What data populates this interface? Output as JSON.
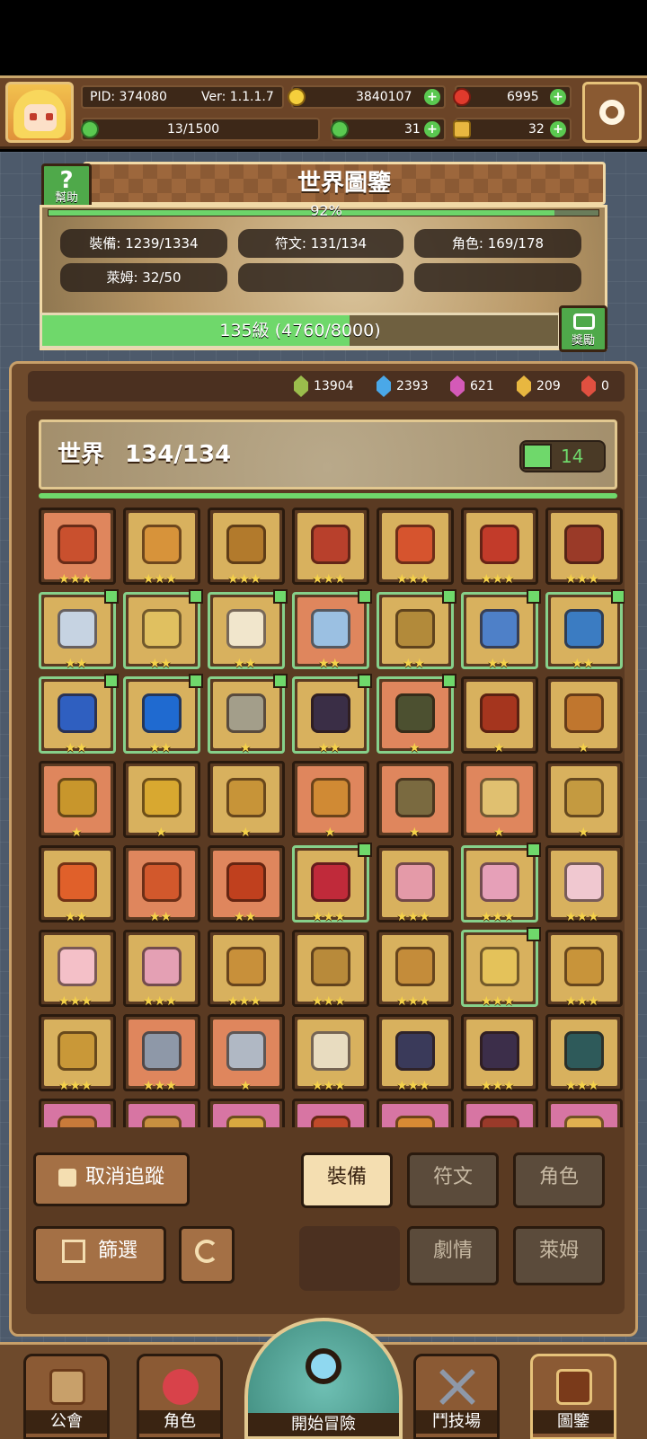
{
  "hud": {
    "pid": "PID: 374080",
    "ver": "Ver: 1.1.1.7",
    "gold": "3840107",
    "ruby": "6995",
    "stamina": "13/1500",
    "clover": "31",
    "key": "32"
  },
  "atlas": {
    "title": "世界圖鑒",
    "help": "幫助",
    "percent": "92%",
    "percent_value": 0.92,
    "stats": [
      "裝備: 1239/1334",
      "符文: 131/134",
      "角色: 169/178",
      "萊姆: 32/50"
    ],
    "level_text": "135級 (4760/8000)",
    "level_progress": 0.595,
    "reward": "獎勵"
  },
  "gems": [
    {
      "color": "#9bbd4c",
      "value": "13904"
    },
    {
      "color": "#4aa8e8",
      "value": "2393"
    },
    {
      "color": "#d45ab8",
      "value": "621"
    },
    {
      "color": "#e8b740",
      "value": "209"
    },
    {
      "color": "#e05040",
      "value": "0"
    }
  ],
  "world": {
    "title": "世界",
    "count": "134/134",
    "likes": "14"
  },
  "items": [
    {
      "bg": "orange",
      "stars": 3,
      "thumb": false,
      "color": "#c9502e"
    },
    {
      "bg": "gold",
      "stars": 3,
      "thumb": false,
      "color": "#d7933a"
    },
    {
      "bg": "gold",
      "stars": 3,
      "thumb": false,
      "color": "#b27a2c"
    },
    {
      "bg": "gold",
      "stars": 3,
      "thumb": false,
      "color": "#b8402c"
    },
    {
      "bg": "gold",
      "stars": 3,
      "thumb": false,
      "color": "#d6542e"
    },
    {
      "bg": "gold",
      "stars": 3,
      "thumb": false,
      "color": "#c23b2a"
    },
    {
      "bg": "gold",
      "stars": 3,
      "thumb": false,
      "color": "#9a3a28"
    },
    {
      "bg": "gold",
      "stars": 2,
      "thumb": true,
      "color": "#c6d3e2",
      "green": true
    },
    {
      "bg": "gold",
      "stars": 2,
      "thumb": true,
      "color": "#e0c060",
      "green": true
    },
    {
      "bg": "gold",
      "stars": 2,
      "thumb": true,
      "color": "#f1e6cc",
      "green": true
    },
    {
      "bg": "orange",
      "stars": 2,
      "thumb": true,
      "color": "#9bc0e2",
      "green": true
    },
    {
      "bg": "gold",
      "stars": 2,
      "thumb": true,
      "color": "#b28a3a",
      "green": true
    },
    {
      "bg": "gold",
      "stars": 2,
      "thumb": true,
      "color": "#4e80c8",
      "green": true
    },
    {
      "bg": "gold",
      "stars": 2,
      "thumb": true,
      "color": "#3b7cc2",
      "green": true
    },
    {
      "bg": "gold",
      "stars": 2,
      "thumb": true,
      "color": "#2f5fc0",
      "green": true
    },
    {
      "bg": "gold",
      "stars": 2,
      "thumb": true,
      "color": "#1f6ad0",
      "green": true
    },
    {
      "bg": "gold",
      "stars": 1,
      "thumb": true,
      "color": "#a39e8a",
      "green": true
    },
    {
      "bg": "gold",
      "stars": 2,
      "thumb": true,
      "color": "#3a2e46",
      "green": true
    },
    {
      "bg": "orange",
      "stars": 1,
      "thumb": true,
      "color": "#4c5030",
      "green": true
    },
    {
      "bg": "gold",
      "stars": 1,
      "thumb": false,
      "color": "#a5351e"
    },
    {
      "bg": "gold",
      "stars": 1,
      "thumb": false,
      "color": "#c0762e"
    },
    {
      "bg": "orange",
      "stars": 1,
      "thumb": false,
      "color": "#c8962c"
    },
    {
      "bg": "gold",
      "stars": 1,
      "thumb": false,
      "color": "#d8a830"
    },
    {
      "bg": "gold",
      "stars": 1,
      "thumb": false,
      "color": "#c79438"
    },
    {
      "bg": "orange",
      "stars": 1,
      "thumb": false,
      "color": "#d08a34"
    },
    {
      "bg": "orange",
      "stars": 1,
      "thumb": false,
      "color": "#7a6a40"
    },
    {
      "bg": "orange",
      "stars": 1,
      "thumb": false,
      "color": "#e0c070"
    },
    {
      "bg": "gold",
      "stars": 1,
      "thumb": false,
      "color": "#c49a40"
    },
    {
      "bg": "gold",
      "stars": 2,
      "thumb": false,
      "color": "#e0602a"
    },
    {
      "bg": "orange",
      "stars": 2,
      "thumb": false,
      "color": "#d2582c"
    },
    {
      "bg": "orange",
      "stars": 2,
      "thumb": false,
      "color": "#c0401e"
    },
    {
      "bg": "gold",
      "stars": 3,
      "thumb": true,
      "color": "#c02a3a",
      "green": true
    },
    {
      "bg": "gold",
      "stars": 3,
      "thumb": false,
      "color": "#e49aa8"
    },
    {
      "bg": "gold",
      "stars": 3,
      "thumb": true,
      "color": "#e6a0b8",
      "green": true
    },
    {
      "bg": "gold",
      "stars": 3,
      "thumb": false,
      "color": "#f0c8d0"
    },
    {
      "bg": "gold",
      "stars": 3,
      "thumb": false,
      "color": "#f4c0c8"
    },
    {
      "bg": "gold",
      "stars": 3,
      "thumb": false,
      "color": "#e4a0b4"
    },
    {
      "bg": "gold",
      "stars": 3,
      "thumb": false,
      "color": "#c8903a"
    },
    {
      "bg": "gold",
      "stars": 3,
      "thumb": false,
      "color": "#b88a3a"
    },
    {
      "bg": "gold",
      "stars": 3,
      "thumb": false,
      "color": "#c48c3a"
    },
    {
      "bg": "gold",
      "stars": 3,
      "thumb": true,
      "color": "#e4c25a",
      "green": true
    },
    {
      "bg": "gold",
      "stars": 3,
      "thumb": false,
      "color": "#c8943a"
    },
    {
      "bg": "gold",
      "stars": 3,
      "thumb": false,
      "color": "#c99838"
    },
    {
      "bg": "orange",
      "stars": 3,
      "thumb": false,
      "color": "#8e98a8"
    },
    {
      "bg": "orange",
      "stars": 1,
      "thumb": false,
      "color": "#b0b8c4"
    },
    {
      "bg": "gold",
      "stars": 3,
      "thumb": false,
      "color": "#e8dcc0"
    },
    {
      "bg": "gold",
      "stars": 3,
      "thumb": false,
      "color": "#3a3a5a"
    },
    {
      "bg": "gold",
      "stars": 3,
      "thumb": false,
      "color": "#3c2e4a"
    },
    {
      "bg": "gold",
      "stars": 3,
      "thumb": false,
      "color": "#2e5a5a"
    },
    {
      "bg": "pink",
      "stars": 0,
      "thumb": false,
      "color": "#c87a3a"
    },
    {
      "bg": "pink",
      "stars": 0,
      "thumb": false,
      "color": "#c89040"
    },
    {
      "bg": "pink",
      "stars": 0,
      "thumb": false,
      "color": "#d8a840"
    },
    {
      "bg": "pink",
      "stars": 0,
      "thumb": false,
      "color": "#c04a2a"
    },
    {
      "bg": "pink",
      "stars": 0,
      "thumb": false,
      "color": "#d88a34"
    },
    {
      "bg": "pink",
      "stars": 0,
      "thumb": false,
      "color": "#9a3a2a"
    },
    {
      "bg": "pink",
      "stars": 0,
      "thumb": false,
      "color": "#e0b050"
    }
  ],
  "buttons": {
    "untrack": "取消追蹤",
    "filter": "篩選",
    "equip": "裝備",
    "rune": "符文",
    "role": "角色",
    "story": "劇情",
    "slime": "萊姆"
  },
  "nav": {
    "guild": "公會",
    "role": "角色",
    "start": "開始冒險",
    "arena": "鬥技場",
    "atlas": "圖鑒"
  }
}
